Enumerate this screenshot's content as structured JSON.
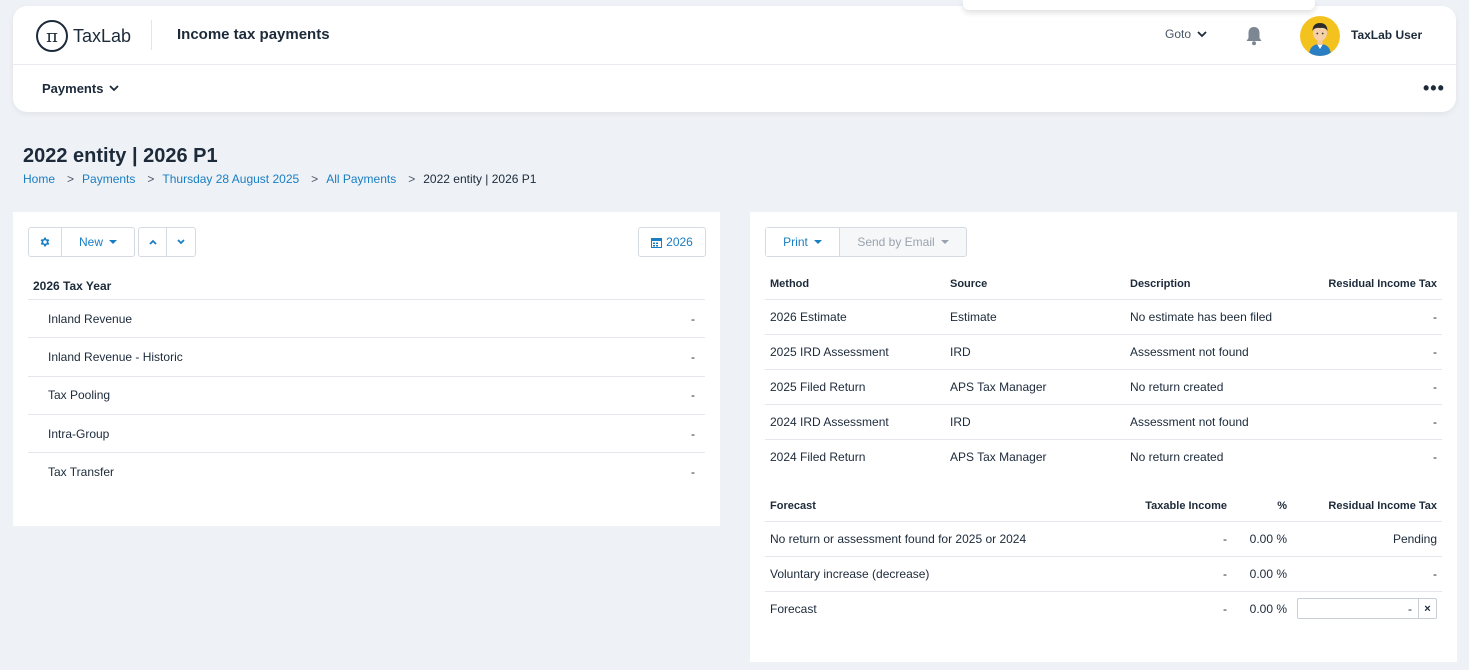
{
  "header": {
    "logo_symbol": "π",
    "logo_text": "TaxLab",
    "app_title": "Income tax payments",
    "goto_label": "Goto",
    "user_name": "TaxLab User"
  },
  "subnav": {
    "payments_label": "Payments",
    "more_label": "•••"
  },
  "page": {
    "title": "2022 entity | 2026 P1",
    "breadcrumb": [
      "Home",
      "Payments",
      "Thursday 28 August 2025",
      "All Payments",
      "2022 entity | 2026 P1"
    ]
  },
  "left_toolbar": {
    "new_label": "New",
    "year_label": "2026"
  },
  "left_table": {
    "heading": "2026 Tax Year",
    "rows": [
      {
        "label": "Inland Revenue",
        "value": "-"
      },
      {
        "label": "Inland Revenue - Historic",
        "value": "-"
      },
      {
        "label": "Tax Pooling",
        "value": "-"
      },
      {
        "label": "Intra-Group",
        "value": "-"
      },
      {
        "label": "Tax Transfer",
        "value": "-"
      }
    ]
  },
  "right_toolbar": {
    "print_label": "Print",
    "email_label": "Send by Email"
  },
  "methods_table": {
    "headers": [
      "Method",
      "Source",
      "Description",
      "Residual Income Tax"
    ],
    "rows": [
      [
        "2026 Estimate",
        "Estimate",
        "No estimate has been filed",
        "-"
      ],
      [
        "2025 IRD Assessment",
        "IRD",
        "Assessment not found",
        "-"
      ],
      [
        "2025 Filed Return",
        "APS Tax Manager",
        "No return created",
        "-"
      ],
      [
        "2024 IRD Assessment",
        "IRD",
        "Assessment not found",
        "-"
      ],
      [
        "2024 Filed Return",
        "APS Tax Manager",
        "No return created",
        "-"
      ]
    ]
  },
  "forecast_table": {
    "headers": [
      "Forecast",
      "Taxable Income",
      "%",
      "Residual Income Tax"
    ],
    "rows": [
      [
        "No return or assessment found for 2025 or 2024",
        "-",
        "0.00 %",
        "Pending"
      ],
      [
        "Voluntary increase (decrease)",
        "-",
        "0.00 %",
        "-"
      ],
      [
        "Forecast",
        "-",
        "0.00 %",
        ""
      ]
    ],
    "forecast_input_value": "-",
    "clear_label": "×"
  },
  "colors": {
    "accent": "#1a7ec2",
    "background": "#eef1f6",
    "text": "#1c2a3a",
    "avatar": "#f4c21f"
  }
}
